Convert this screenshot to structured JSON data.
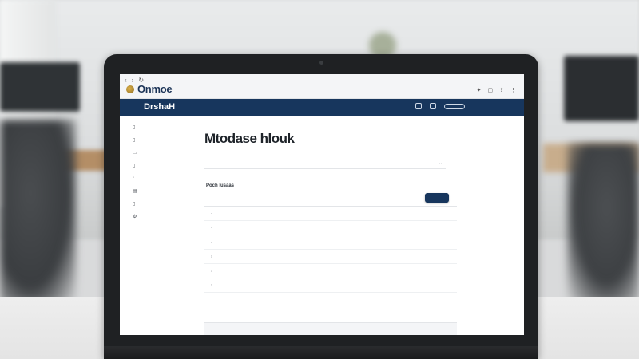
{
  "browser": {
    "brand_name": "Onmoe",
    "tab_title": "",
    "url": ""
  },
  "app": {
    "logo_text": "DrshaH",
    "menu": [
      "",
      "",
      "",
      ""
    ]
  },
  "sidebar": {
    "items": [
      {
        "label": "",
        "icon": "document-icon"
      },
      {
        "label": "",
        "icon": "document-icon"
      },
      {
        "label": "",
        "icon": "folder-icon"
      },
      {
        "label": "",
        "icon": "document-icon"
      },
      {
        "label": "",
        "icon": "user-icon"
      },
      {
        "label": "",
        "icon": "chart-icon"
      },
      {
        "label": "",
        "icon": "document-icon"
      },
      {
        "label": "",
        "icon": "settings-icon"
      }
    ]
  },
  "main": {
    "page_title": "Mtodase hlouk",
    "filter_placeholder": "",
    "section_title": "Poch lusaas",
    "section_subtitle": "",
    "action_button_label": "",
    "rows": [
      "",
      "",
      "",
      "",
      "",
      ""
    ],
    "pager": "",
    "footer_text": ""
  },
  "colors": {
    "brand_navy": "#17365d",
    "content_bg": "#ffffff",
    "laptop_bezel": "#1f2123"
  }
}
